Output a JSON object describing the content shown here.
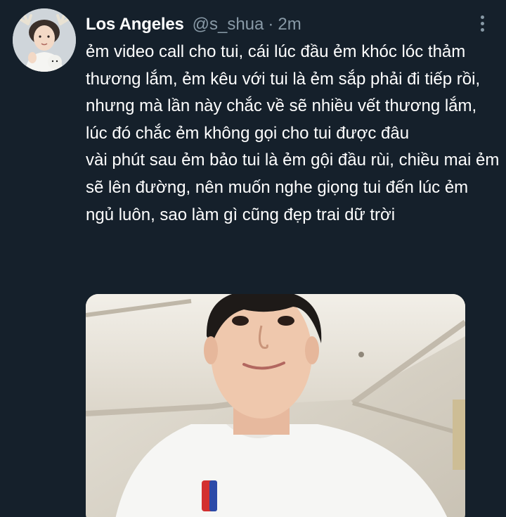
{
  "tweet": {
    "author": {
      "display_name": "Los Angeles",
      "handle": "@s_shua",
      "separator": "·",
      "time": "2m",
      "avatar_icon": "avatar-photo"
    },
    "more_icon": "more-vertical-icon",
    "paragraphs": [
      "ẻm video call cho tui, cái lúc đầu ẻm khóc lóc thảm thương lắm, ẻm kêu với tui là ẻm sắp phải đi tiếp rồi, nhưng mà lần này chắc về sẽ nhiều vết thương lắm, lúc đó chắc ẻm không gọi cho tui được đâu",
      "vài phút sau ẻm bảo tui là ẻm gội đầu rùi, chiều mai ẻm sẽ lên đường, nên muốn nghe giọng tui đến lúc ẻm ngủ luôn, sao làm gì cũng đẹp trai dữ trời"
    ],
    "media": {
      "type": "photo"
    }
  },
  "colors": {
    "background": "#15202b",
    "text": "#ffffff",
    "secondary_text": "#8899a6"
  }
}
